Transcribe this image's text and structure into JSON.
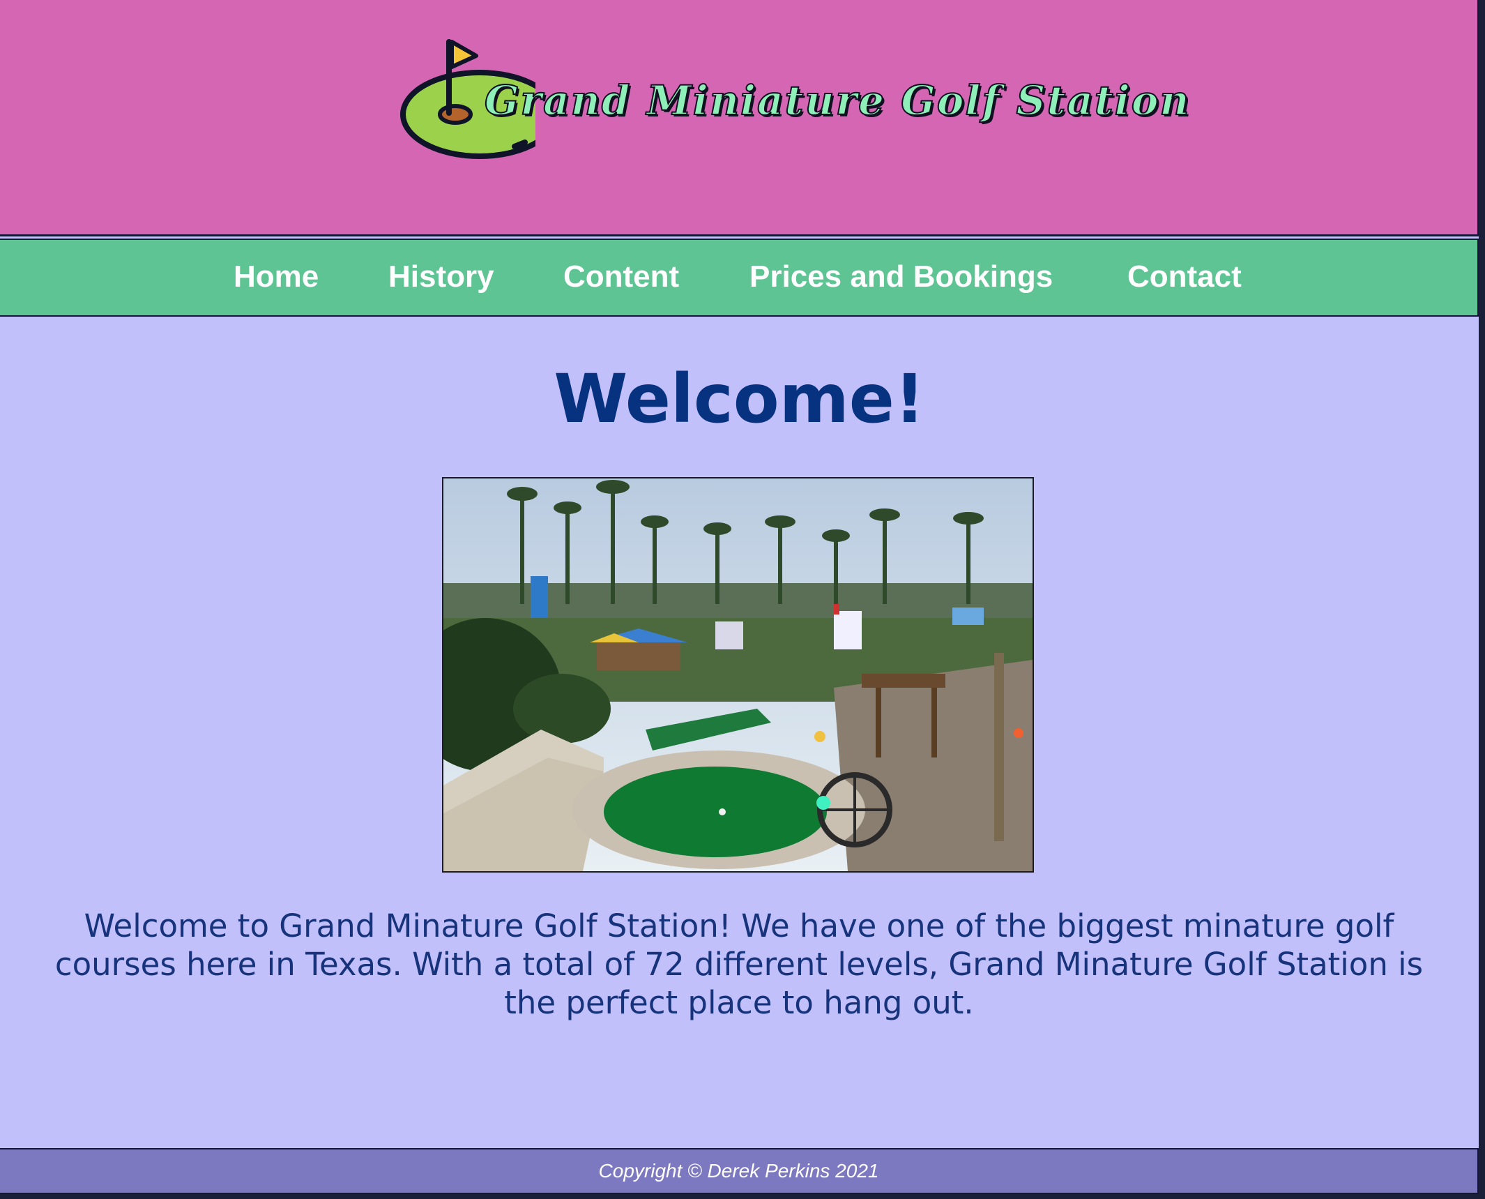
{
  "header": {
    "logo_text": "Grand Miniature Golf Station",
    "logo_icon": "golf-green-flag-icon"
  },
  "nav": {
    "items": [
      {
        "label": "Home"
      },
      {
        "label": "History"
      },
      {
        "label": "Content"
      },
      {
        "label": "Prices and Bookings"
      },
      {
        "label": "Contact"
      }
    ]
  },
  "main": {
    "heading": "Welcome!",
    "image": "miniature-golf-course-photo",
    "intro": "Welcome to Grand Minature Golf Station! We have one of the biggest minature golf courses here in Texas. With a total of 72 different levels, Grand Minature Golf Station is the perfect place to hang out."
  },
  "footer": {
    "copyright": "Copyright © Derek Perkins 2021"
  },
  "colors": {
    "header_bg": "#d566b3",
    "nav_bg": "#5fc493",
    "page_bg": "#c2c0fa",
    "footer_bg": "#7d79c1",
    "heading_color": "#073280",
    "logo_text_color": "#8ef0b8"
  }
}
